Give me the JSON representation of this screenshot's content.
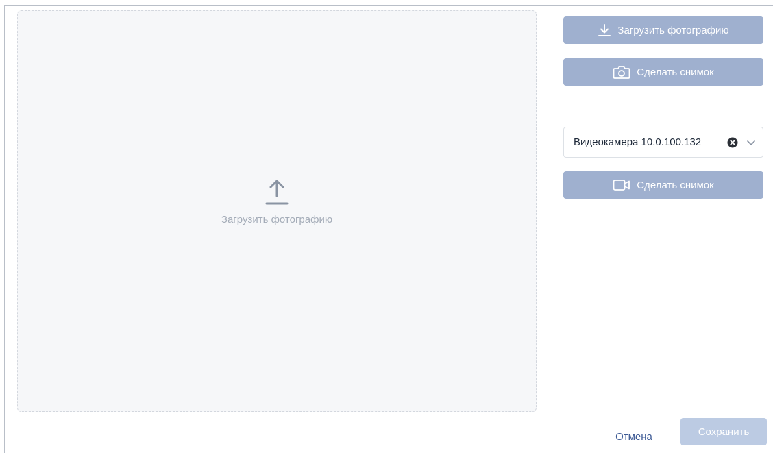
{
  "dropzone": {
    "label": "Загрузить фотографию",
    "icon": "upload-icon"
  },
  "side": {
    "upload_button": {
      "label": "Загрузить фотографию",
      "icon": "download-icon"
    },
    "snapshot_button": {
      "label": "Сделать снимок",
      "icon": "camera-icon"
    },
    "camera_select": {
      "value": "Видеокамера 10.0.100.132",
      "clear_icon": "clear-icon",
      "chevron_icon": "chevron-down-icon"
    },
    "video_snapshot_button": {
      "label": "Сделать снимок",
      "icon": "video-camera-icon"
    }
  },
  "footer": {
    "cancel_label": "Отмена",
    "save_label": "Сохранить"
  },
  "colors": {
    "button_bg": "#9fb0cf",
    "save_disabled_bg": "#bccbe3",
    "link": "#3d5a95",
    "dropzone_bg": "#f6f7f9"
  }
}
